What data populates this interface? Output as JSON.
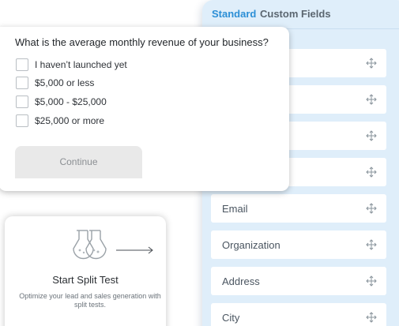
{
  "fields_panel": {
    "tabs": [
      {
        "label": "Standard",
        "active": true
      },
      {
        "label": "Custom Fields",
        "active": false
      }
    ],
    "fields": [
      {
        "label": ""
      },
      {
        "label": ""
      },
      {
        "label": ""
      },
      {
        "label": ""
      },
      {
        "label": "Email"
      },
      {
        "label": "Organization"
      },
      {
        "label": "Address"
      },
      {
        "label": "City"
      }
    ],
    "row_icon": "move-icon"
  },
  "split_test": {
    "icon": "flask-icon",
    "arrow": "arrow-right-icon",
    "title": "Start Split Test",
    "description": "Optimize your lead and sales generation with split tests."
  },
  "question": {
    "text": "What is the average monthly revenue of your business?",
    "options": [
      {
        "label": "I haven’t launched yet",
        "checked": false
      },
      {
        "label": "$5,000 or less",
        "checked": false
      },
      {
        "label": "$5,000 - $25,000",
        "checked": false
      },
      {
        "label": "$25,000 or more",
        "checked": false
      }
    ],
    "continue_label": "Continue"
  },
  "colors": {
    "accent": "#2c8fd6",
    "panel_bg": "#dfeefa",
    "button_bg": "#e9e9e9"
  }
}
